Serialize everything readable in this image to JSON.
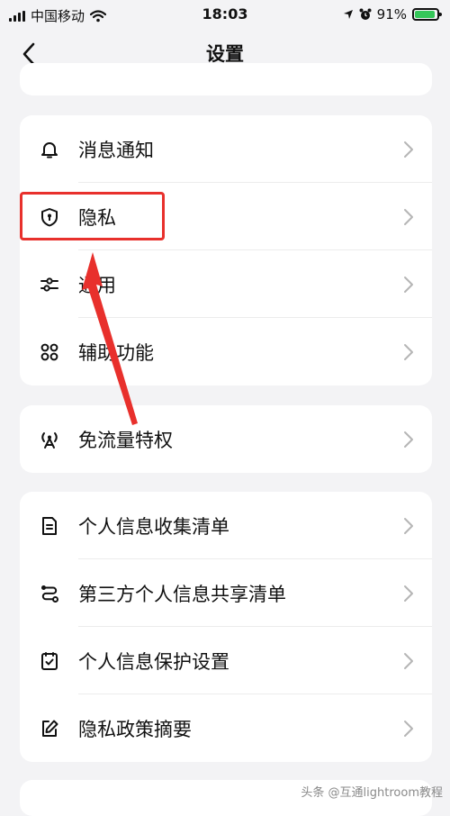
{
  "status_bar": {
    "carrier": "中国移动",
    "time": "18:03",
    "battery": "91%"
  },
  "nav": {
    "title": "设置"
  },
  "groups": [
    {
      "items": [
        {
          "label": "消息通知",
          "icon": "bell-icon"
        },
        {
          "label": "隐私",
          "icon": "shield-icon"
        },
        {
          "label": "通用",
          "icon": "sliders-icon"
        },
        {
          "label": "辅助功能",
          "icon": "command-icon"
        }
      ]
    },
    {
      "items": [
        {
          "label": "免流量特权",
          "icon": "broadcast-icon"
        }
      ]
    },
    {
      "items": [
        {
          "label": "个人信息收集清单",
          "icon": "document-list-icon"
        },
        {
          "label": "第三方个人信息共享清单",
          "icon": "share-route-icon"
        },
        {
          "label": "个人信息保护设置",
          "icon": "checkbox-icon"
        },
        {
          "label": "隐私政策摘要",
          "icon": "edit-icon"
        }
      ]
    }
  ],
  "annotation": {
    "highlight_color": "#e8302c"
  },
  "watermark": {
    "text": "头条 @互通lightroom教程"
  }
}
